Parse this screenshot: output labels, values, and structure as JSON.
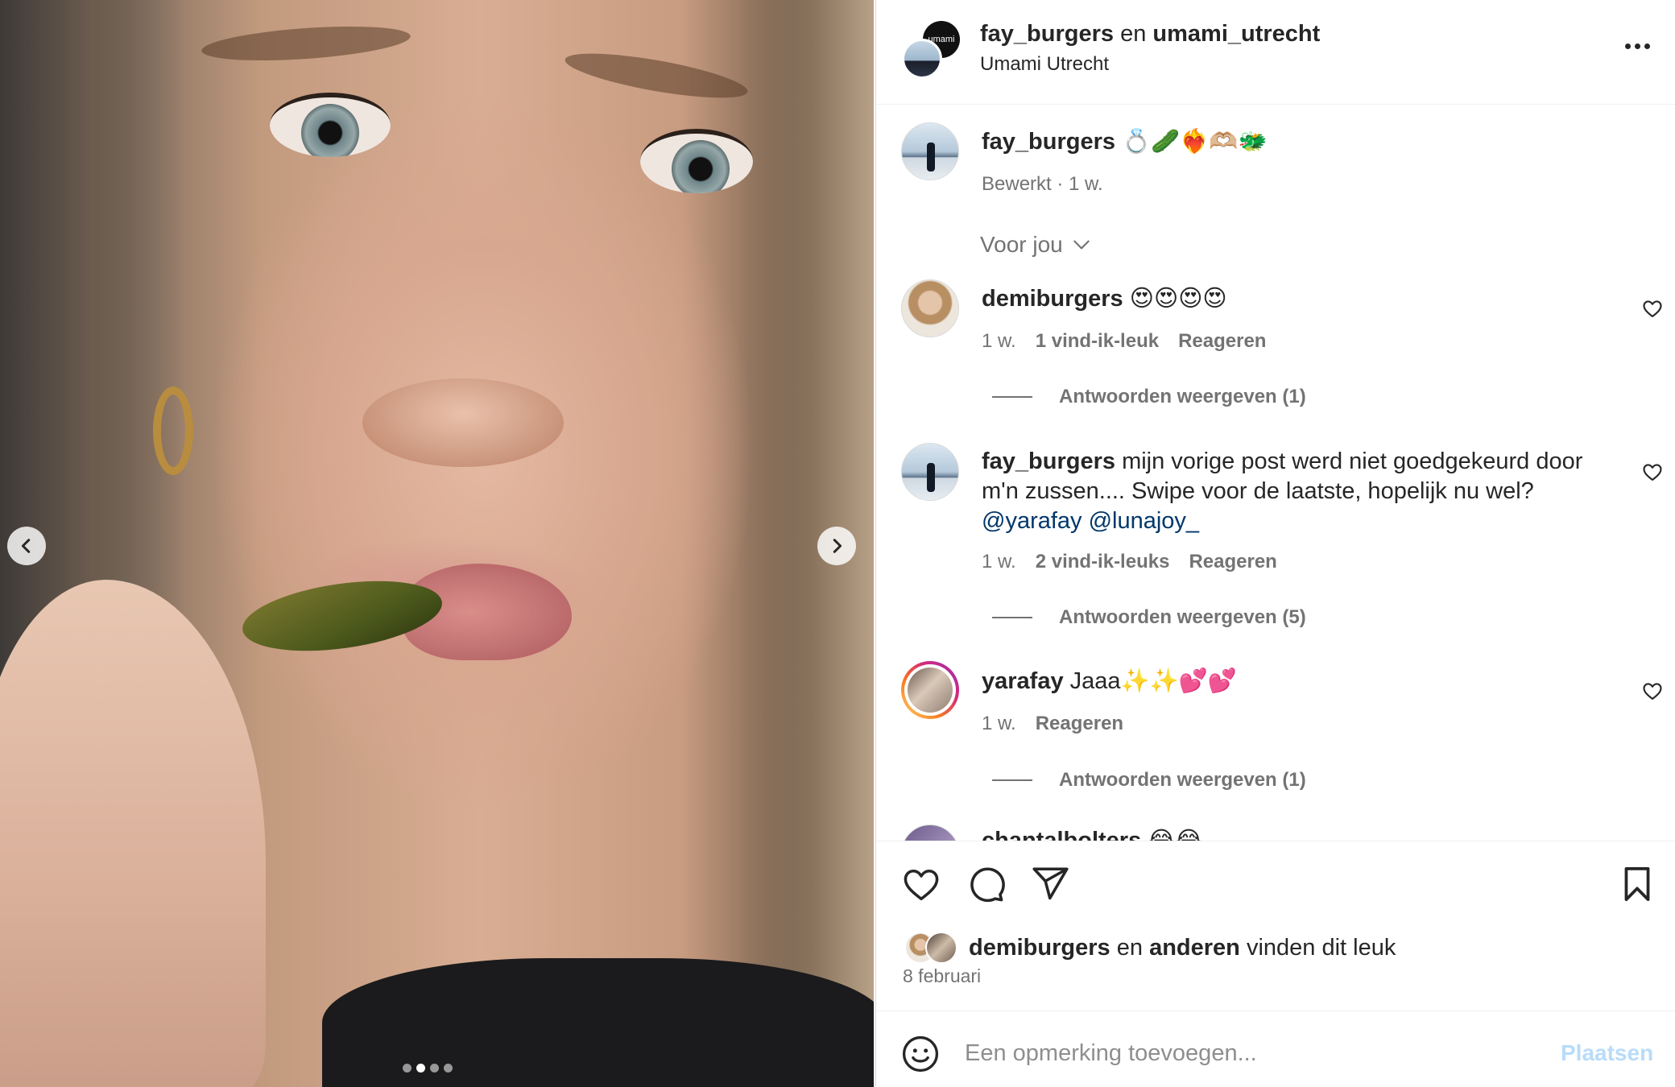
{
  "header": {
    "user1": "fay_burgers",
    "joiner": "en",
    "user2": "umami_utrecht",
    "location": "Umami Utrecht",
    "collab_badge_text": "umami"
  },
  "caption": {
    "username": "fay_burgers",
    "emojis": "💍🥒❤️‍🔥🫶🏼🐲",
    "meta": "Bewerkt · 1 w."
  },
  "filter": {
    "label": "Voor jou"
  },
  "comments": [
    {
      "username": "demiburgers",
      "text": "😍😍😍😍",
      "time": "1 w.",
      "likes": "1 vind-ik-leuk",
      "reply": "Reageren",
      "replies": "Antwoorden weergeven (1)"
    },
    {
      "username": "fay_burgers",
      "text": "mijn vorige post werd niet goedgekeurd door m'n zussen.... Swipe voor de laatste, hopelijk nu wel?",
      "mentions": "@yarafay @lunajoy_",
      "time": "1 w.",
      "likes": "2 vind-ik-leuks",
      "reply": "Reageren",
      "replies": "Antwoorden weergeven (5)"
    },
    {
      "username": "yarafay",
      "text": "Jaaa✨✨💕💕",
      "time": "1 w.",
      "reply": "Reageren",
      "replies": "Antwoorden weergeven (1)"
    },
    {
      "username": "chantalbolters",
      "text": "😂😂"
    }
  ],
  "likes": {
    "user": "demiburgers",
    "joiner": "en",
    "others": "anderen",
    "suffix": "vinden dit leuk"
  },
  "date": "8 februari",
  "composer": {
    "placeholder": "Een opmerking toevoegen...",
    "post_label": "Plaatsen"
  },
  "carousel": {
    "slides": 4,
    "active_index": 1
  },
  "colors": {
    "link": "#00376b",
    "muted": "#737373",
    "post_disabled": "#b8dcf9",
    "story_ring": "#d62976"
  }
}
